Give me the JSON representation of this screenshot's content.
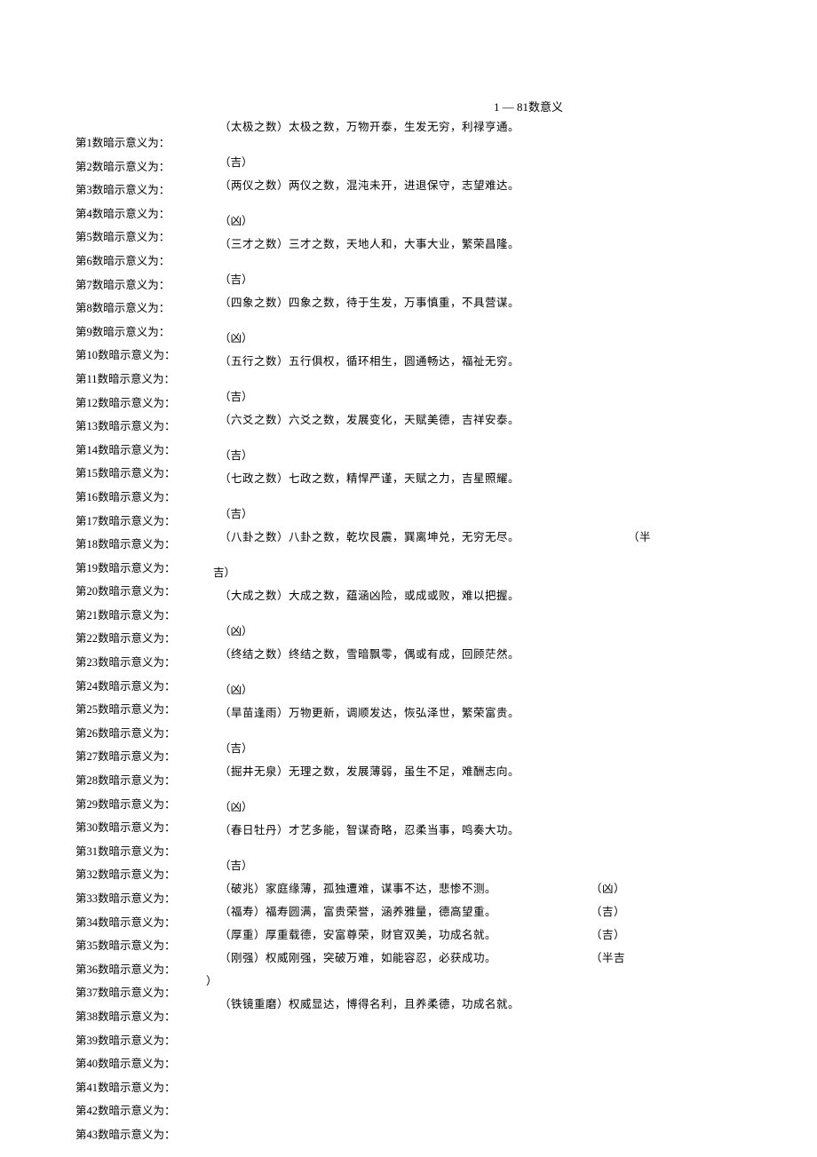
{
  "title": "1 — 81数意义",
  "left_items": [
    "第1数暗示意义为：",
    "第2数暗示意义为：",
    "第3数暗示意义为：",
    "第4数暗示意义为：",
    "第5数暗示意义为：",
    "第6数暗示意义为：",
    "第7数暗示意义为：",
    "第8数暗示意义为：",
    "第9数暗示意义为：",
    "第10数暗示意义为：",
    "第11数暗示意义为：",
    "第12数暗示意义为：",
    "第13数暗示意义为：",
    "第14数暗示意义为：",
    "第15数暗示意义为：",
    "第16数暗示意义为：",
    "第17数暗示意义为：",
    "第18数暗示意义为：",
    "第19数暗示意义为：",
    "第20数暗示意义为：",
    "第21数暗示意义为：",
    "第22数暗示意义为：",
    "第23数暗示意义为：",
    "第24数暗示意义为：",
    "第25数暗示意义为：",
    "第26数暗示意义为：",
    "第27数暗示意义为：",
    "第28数暗示意义为：",
    "第29数暗示意义为：",
    "第30数暗示意义为：",
    "第31数暗示意义为：",
    "第32数暗示意义为：",
    "第33数暗示意义为：",
    "第34数暗示意义为：",
    "第35数暗示意义为：",
    "第36数暗示意义为：",
    "第37数暗示意义为：",
    "第38数暗示意义为：",
    "第39数暗示意义为：",
    "第40数暗示意义为：",
    "第41数暗示意义为：",
    "第42数暗示意义为：",
    "第43数暗示意义为："
  ],
  "meanings": [
    {
      "text": "（太极之数）太极之数，万物开泰，生发无穷，利禄亨通。",
      "rating": "（吉）"
    },
    {
      "text": "（两仪之数）两仪之数，混沌未开，进退保守，志望难达。",
      "rating": "（凶）"
    },
    {
      "text": "（三才之数）三才之数，天地人和，大事大业，繁荣昌隆。",
      "rating": "（吉）"
    },
    {
      "text": "（四象之数）四象之数，待于生发，万事慎重，不具营谋。",
      "rating": "（凶）"
    },
    {
      "text": "（五行之数）五行俱权，循环相生，圆通畅达，福祉无穷。",
      "rating": "（吉）"
    },
    {
      "text": "（六爻之数）六爻之数，发展变化，天赋美德，吉祥安泰。",
      "rating": "（吉）"
    },
    {
      "text": "（七政之数）七政之数，精悍严谨，天赋之力，吉星照耀。",
      "rating": "（吉）"
    },
    {
      "text": "（八卦之数）八卦之数，乾坎艮震，巽离坤兑，无穷无尽。",
      "rating": "（半",
      "rating2": "吉）"
    },
    {
      "text": "（大成之数）大成之数，蕴涵凶险，或成或败，难以把握。",
      "rating": "（凶）"
    },
    {
      "text": " （终结之数）终结之数，雪暗飘零，偶或有成，回顾茫然。",
      "rating": "（凶）"
    },
    {
      "text": " （旱苗逢雨）万物更新，调顺发达，恢弘泽世，繁荣富贵。",
      "rating": "（吉）"
    },
    {
      "text": " （掘井无泉）无理之数，发展薄弱，虽生不足，难酬志向。",
      "rating": "（凶）"
    },
    {
      "text": " （春日牡丹）才艺多能，智谋奇略，忍柔当事，鸣奏大功。",
      "rating": "（吉）"
    }
  ],
  "inline_items": [
    {
      "text": " （破兆）家庭缘薄，孤独遭难，谋事不达，悲惨不测。",
      "rating": "（凶）"
    },
    {
      "text": " （福寿）福寿圆满，富贵荣誉，涵养雅量，德高望重。",
      "rating": "（吉）"
    },
    {
      "text": " （厚重）厚重载德，安富尊荣，财官双美，功成名就。",
      "rating": "（吉）"
    },
    {
      "text": " （刚强）权威刚强，突破万难，如能容忍，必获成功。",
      "rating": "（半吉",
      "rating2": "）"
    },
    {
      "text": " （铁镜重磨）权威显达，博得名利，且养柔德，功成名就。",
      "rating": ""
    }
  ]
}
